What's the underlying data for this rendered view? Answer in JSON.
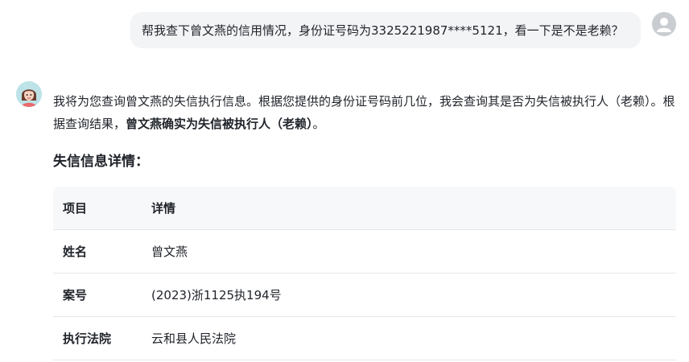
{
  "user_message": {
    "text": "帮我查下曾文燕的信用情况，身份证号码为3325221987****5121，看一下是不是老赖？"
  },
  "assistant_message": {
    "intro": "我将为您查询曾文燕的失信执行信息。根据您提供的身份证号码前几位，我会查询其是否为失信被执行人（老赖）。根据查询结果，",
    "conclusion": "曾文燕确实为失信被执行人（老赖）",
    "ending": "。",
    "section_heading": "失信信息详情："
  },
  "table": {
    "headers": [
      "项目",
      "详情"
    ],
    "rows": [
      {
        "label": "姓名",
        "value": "曾文燕"
      },
      {
        "label": "案号",
        "value": "(2023)浙1125执194号"
      },
      {
        "label": "执行法院",
        "value": "云和县人民法院"
      }
    ]
  },
  "colors": {
    "user_bubble_bg": "#f3f4f6",
    "table_header_bg": "#f7f8fa",
    "border": "#e6e8eb",
    "text": "#1f2329"
  },
  "icons": {
    "user_avatar": "user-avatar-icon",
    "assistant_avatar": "assistant-avatar-icon"
  }
}
